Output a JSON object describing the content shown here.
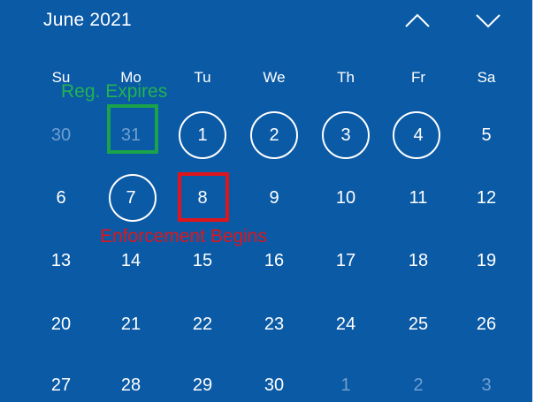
{
  "header": {
    "month_label": "June 2021",
    "prev_icon": "chevron-up-icon",
    "next_icon": "chevron-down-icon"
  },
  "weekdays": [
    "Su",
    "Mo",
    "Tu",
    "We",
    "Th",
    "Fr",
    "Sa"
  ],
  "weeks": [
    [
      "30",
      "31",
      "1",
      "2",
      "3",
      "4",
      "5"
    ],
    [
      "6",
      "7",
      "8",
      "9",
      "10",
      "11",
      "12"
    ],
    [
      "13",
      "14",
      "15",
      "16",
      "17",
      "18",
      "19"
    ],
    [
      "20",
      "21",
      "22",
      "23",
      "24",
      "25",
      "26"
    ],
    [
      "27",
      "28",
      "29",
      "30",
      "1",
      "2",
      "3"
    ]
  ],
  "out_of_month_days": [
    "30",
    "31",
    "1",
    "2",
    "3"
  ],
  "annotations": {
    "green_label": "Reg. Expires",
    "green_marked_day": "31",
    "red_label": "Enforcement Begins",
    "red_marked_day": "8",
    "circled_days": [
      "1",
      "2",
      "3",
      "4",
      "7"
    ]
  },
  "colors": {
    "background": "#0b5aa6",
    "text": "#ffffff",
    "muted_text": "#6f9fd0",
    "green": "#1aa34a",
    "red": "#e0151b"
  }
}
